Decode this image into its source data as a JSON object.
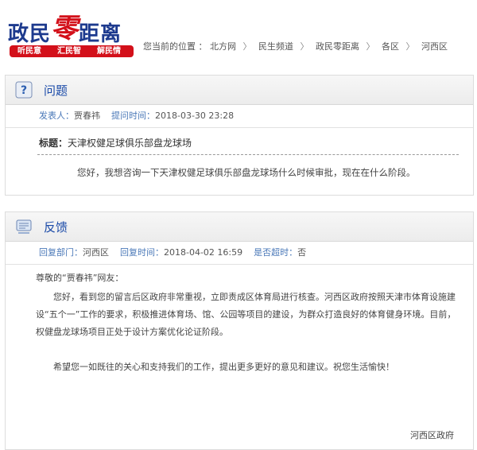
{
  "logo": {
    "title_a": "政民",
    "title_b": "零",
    "title_c": "距离",
    "slogans": [
      "听民意",
      "汇民智",
      "解民情"
    ]
  },
  "breadcrumb": {
    "prefix": "您当前的位置 ：",
    "items": [
      "北方网",
      "民生频道",
      "政民零距离",
      "各区",
      "河西区"
    ],
    "separator": "〉"
  },
  "question": {
    "header": "问题",
    "author_label": "发表人：",
    "author": "贾春祎",
    "time_label": "提问时间：",
    "time": "2018-03-30 23:28",
    "title_label": "标题：",
    "title": "天津权健足球俱乐部盘龙球场",
    "body": "您好，我想咨询一下天津权健足球俱乐部盘龙球场什么时候审批，现在在什么阶段。"
  },
  "answer": {
    "header": "反馈",
    "dept_label": "回复部门：",
    "dept": "河西区",
    "time_label": "回复时间：",
    "time": "2018-04-02 16:59",
    "overdue_label": "是否超时：",
    "overdue": "否",
    "greeting": "尊敬的“贾春祎”网友：",
    "para1": "您好，看到您的留言后区政府非常重视，立即责成区体育局进行核查。河西区政府按照天津市体育设施建设“五个一”工作的要求，积极推进体育场、馆、公园等项目的建设，为群众打造良好的体育健身环境。目前，权健盘龙球场项目正处于设计方案优化论证阶段。",
    "para2": "希望您一如既往的关心和支持我们的工作，提出更多更好的意见和建议。祝您生活愉快！",
    "signature": "河西区政府"
  }
}
